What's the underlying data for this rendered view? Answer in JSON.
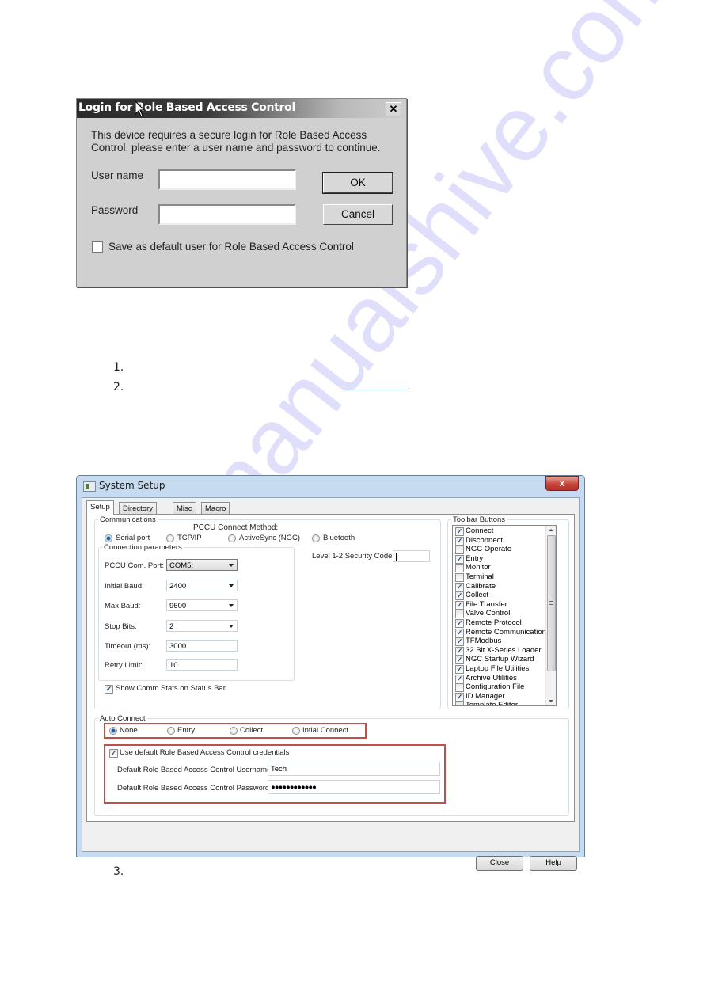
{
  "login_dialog": {
    "title": "Login for Role Based Access Control",
    "close_glyph": "✕",
    "message": "This device requires a secure login for Role Based Access Control, please enter a user name and password to continue.",
    "username_label": "User name",
    "username_value": "",
    "password_label": "Password",
    "password_value": "",
    "ok_label": "OK",
    "cancel_label": "Cancel",
    "save_default_label": "Save as default user for Role Based Access Control",
    "save_default_checked": false
  },
  "steps": [
    {
      "number": "1."
    },
    {
      "number": "2."
    },
    {
      "number": "3."
    }
  ],
  "system_setup": {
    "title": "System Setup",
    "close_glyph": "x",
    "tabs": [
      {
        "label": "Setup",
        "active": true
      },
      {
        "label": "Directory Paths",
        "active": false
      },
      {
        "label": "Misc",
        "active": false
      },
      {
        "label": "Macro Setup",
        "active": false
      }
    ],
    "communications": {
      "legend": "Communications",
      "connect_method_label": "PCCU Connect Method:",
      "methods": [
        {
          "label": "Serial port",
          "selected": true
        },
        {
          "label": "TCP/IP",
          "selected": false
        },
        {
          "label": "ActiveSync (NGC)",
          "selected": false
        },
        {
          "label": "Bluetooth",
          "selected": false
        }
      ],
      "security_code_label": "Level 1-2 Security Code:",
      "security_code_value": "",
      "connection_parameters": {
        "legend": "Connection parameters",
        "fields": [
          {
            "label": "PCCU Com. Port:",
            "value": "COM5:",
            "type": "combo"
          },
          {
            "label": "Initial Baud:",
            "value": "2400",
            "type": "combo"
          },
          {
            "label": "Max Baud:",
            "value": "9600",
            "type": "combo"
          },
          {
            "label": "Stop Bits:",
            "value": "2",
            "type": "combo"
          },
          {
            "label": "Timeout (ms):",
            "value": "3000",
            "type": "text"
          },
          {
            "label": "Retry Limit:",
            "value": "10",
            "type": "text"
          }
        ]
      },
      "show_comm_stats_label": "Show Comm Stats on Status Bar",
      "show_comm_stats_checked": true
    },
    "toolbar_buttons": {
      "legend": "Toolbar Buttons",
      "items": [
        {
          "label": "Connect",
          "checked": true
        },
        {
          "label": "Disconnect",
          "checked": true
        },
        {
          "label": "NGC Operate",
          "checked": false
        },
        {
          "label": "Entry",
          "checked": true
        },
        {
          "label": "Monitor",
          "checked": false
        },
        {
          "label": "Terminal",
          "checked": false
        },
        {
          "label": "Calibrate",
          "checked": true
        },
        {
          "label": "Collect",
          "checked": true
        },
        {
          "label": "File Transfer",
          "checked": true
        },
        {
          "label": "Valve Control",
          "checked": false
        },
        {
          "label": "Remote Protocol",
          "checked": true
        },
        {
          "label": "Remote Communications",
          "checked": true
        },
        {
          "label": "TFModbus",
          "checked": true
        },
        {
          "label": "32 Bit X-Series Loader",
          "checked": true
        },
        {
          "label": "NGC Startup Wizard",
          "checked": true
        },
        {
          "label": "Laptop File Utilities",
          "checked": true
        },
        {
          "label": "Archive Utilities",
          "checked": true
        },
        {
          "label": "Configuration File",
          "checked": false
        },
        {
          "label": "ID Manager",
          "checked": true
        },
        {
          "label": "Template Editor",
          "checked": false
        }
      ]
    },
    "auto_connect": {
      "legend": "Auto Connect",
      "options": [
        {
          "label": "None",
          "selected": true
        },
        {
          "label": "Entry",
          "selected": false
        },
        {
          "label": "Collect",
          "selected": false
        },
        {
          "label": "Intial Connect",
          "selected": false
        }
      ],
      "use_default_label": "Use default Role Based Access Control credentials",
      "use_default_checked": true,
      "username_label": "Default Role Based Access Control Username",
      "username_value": "Tech",
      "password_label": "Default Role Based Access Control Password",
      "password_value": "●●●●●●●●●●●●"
    },
    "close_label": "Close",
    "help_label": "Help"
  },
  "watermark": "manualshive.com",
  "colors": {
    "highlight_box": "#c0504d",
    "link_underline": "#1f4e8c",
    "watermark": "#8c8cf0"
  }
}
